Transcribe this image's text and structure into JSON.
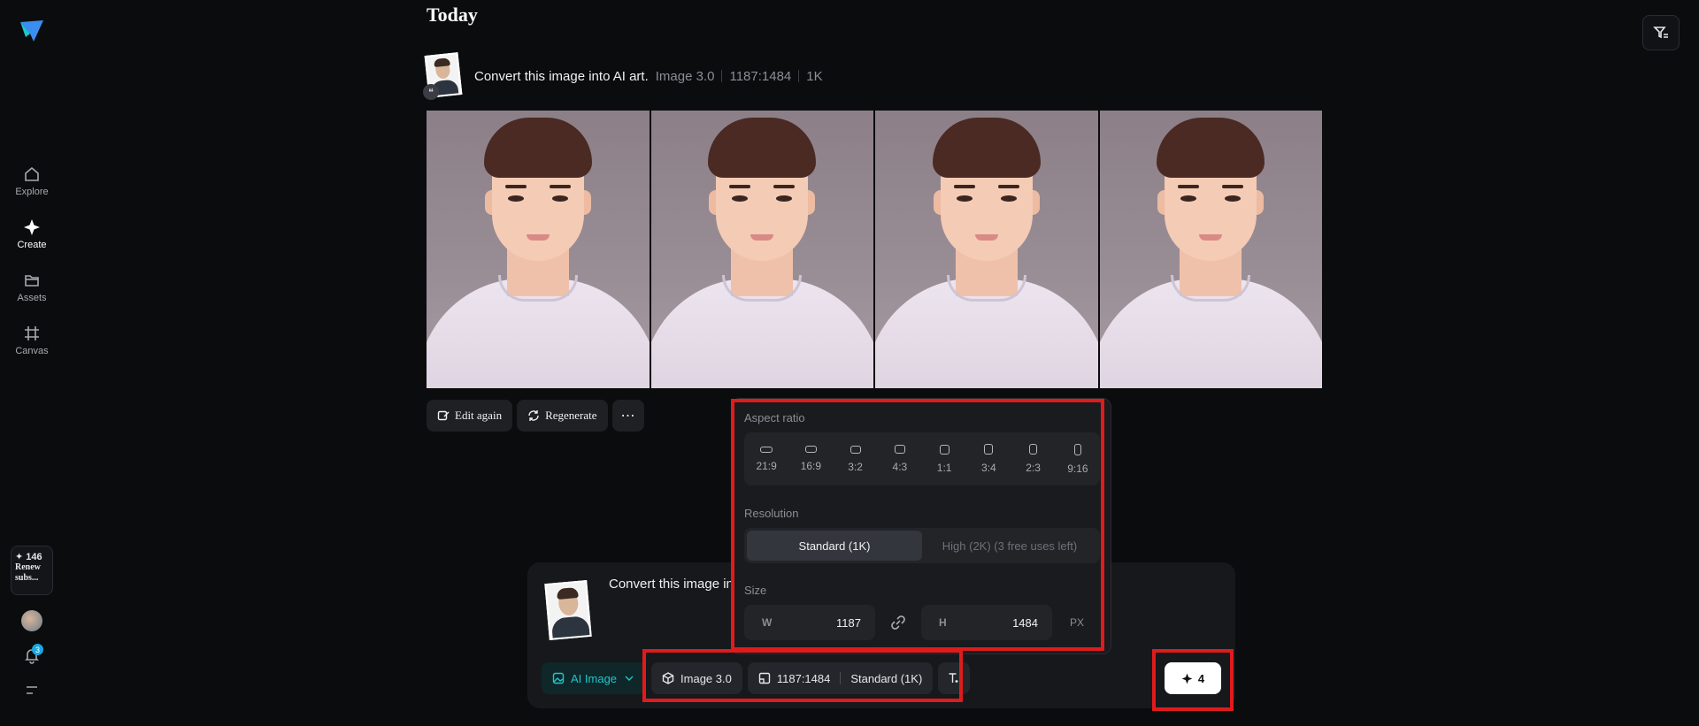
{
  "sidebar": {
    "items": [
      {
        "label": "Explore"
      },
      {
        "label": "Create"
      },
      {
        "label": "Assets"
      },
      {
        "label": "Canvas"
      }
    ],
    "credits": "✦ 146",
    "renew": "Renew subs...",
    "notification_count": "3"
  },
  "feed": {
    "heading": "Today",
    "prompt": "Convert this image into AI art.",
    "model": "Image 3.0",
    "ratio": "1187:1484",
    "resolution": "1K",
    "quote_glyph": "❝"
  },
  "actions": {
    "edit_again": "Edit again",
    "regenerate": "Regenerate",
    "more": "⋯"
  },
  "popover": {
    "aspect_label": "Aspect ratio",
    "ratios": [
      "21:9",
      "16:9",
      "3:2",
      "4:3",
      "1:1",
      "3:4",
      "2:3",
      "9:16"
    ],
    "resolution_label": "Resolution",
    "res_standard": "Standard (1K)",
    "res_high": "High (2K)  (3 free uses left)",
    "size_label": "Size",
    "w_label": "W",
    "w_value": "1187",
    "h_label": "H",
    "h_value": "1484",
    "unit": "PX"
  },
  "composer": {
    "prompt_preview": "Convert this image in",
    "mode": "AI Image",
    "model": "Image 3.0",
    "ratio": "1187:1484",
    "resolution": "Standard (1K)",
    "generate_count": "4"
  },
  "colors": {
    "accent": "#1dc7c9",
    "annotation": "#e01b1b"
  }
}
